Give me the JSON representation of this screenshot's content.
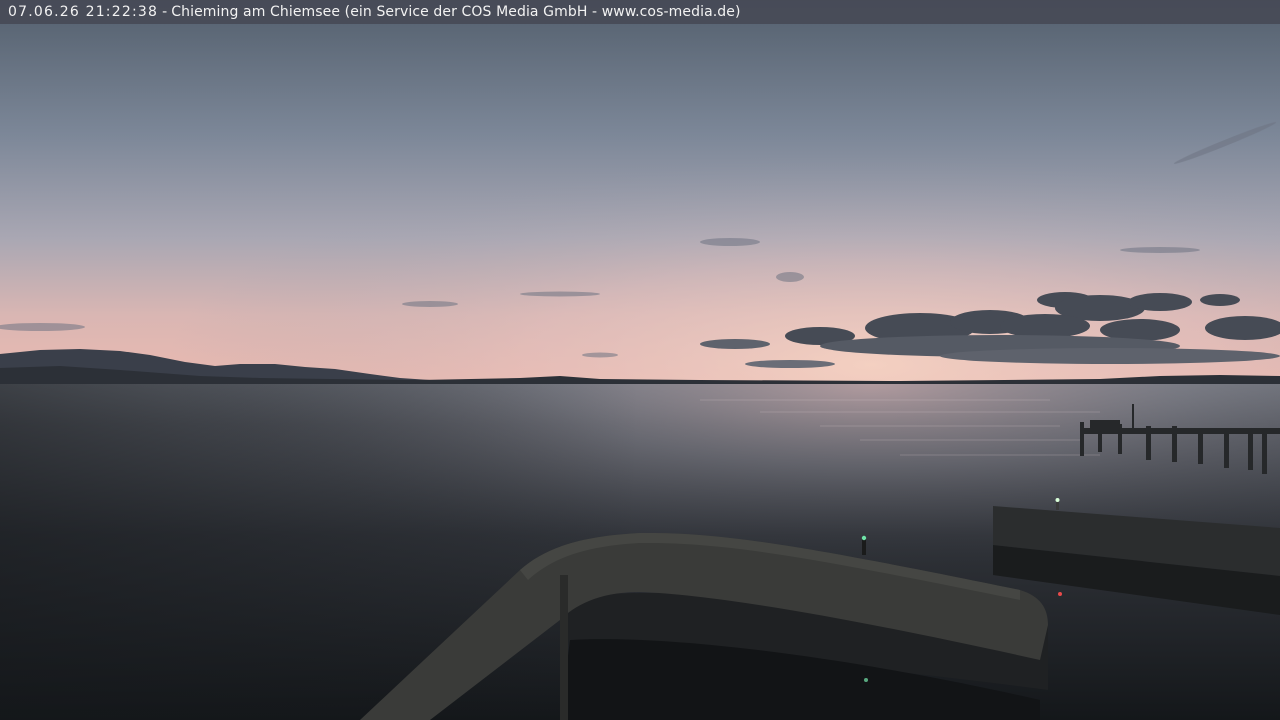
{
  "overlay": {
    "timestamp": "07.06.26 21:22:38",
    "separator": "-",
    "location": "Chieming am Chiemsee (ein Service der COS Media GmbH - www.cos-media.de)"
  },
  "scene": {
    "subject": "sunset-over-lake-with-harbor-pier",
    "colors": {
      "sky_top": "#55616e",
      "sky_horizon": "#e6b6b0",
      "water_dark": "#16191c",
      "pier": "#2a2c2c"
    }
  }
}
